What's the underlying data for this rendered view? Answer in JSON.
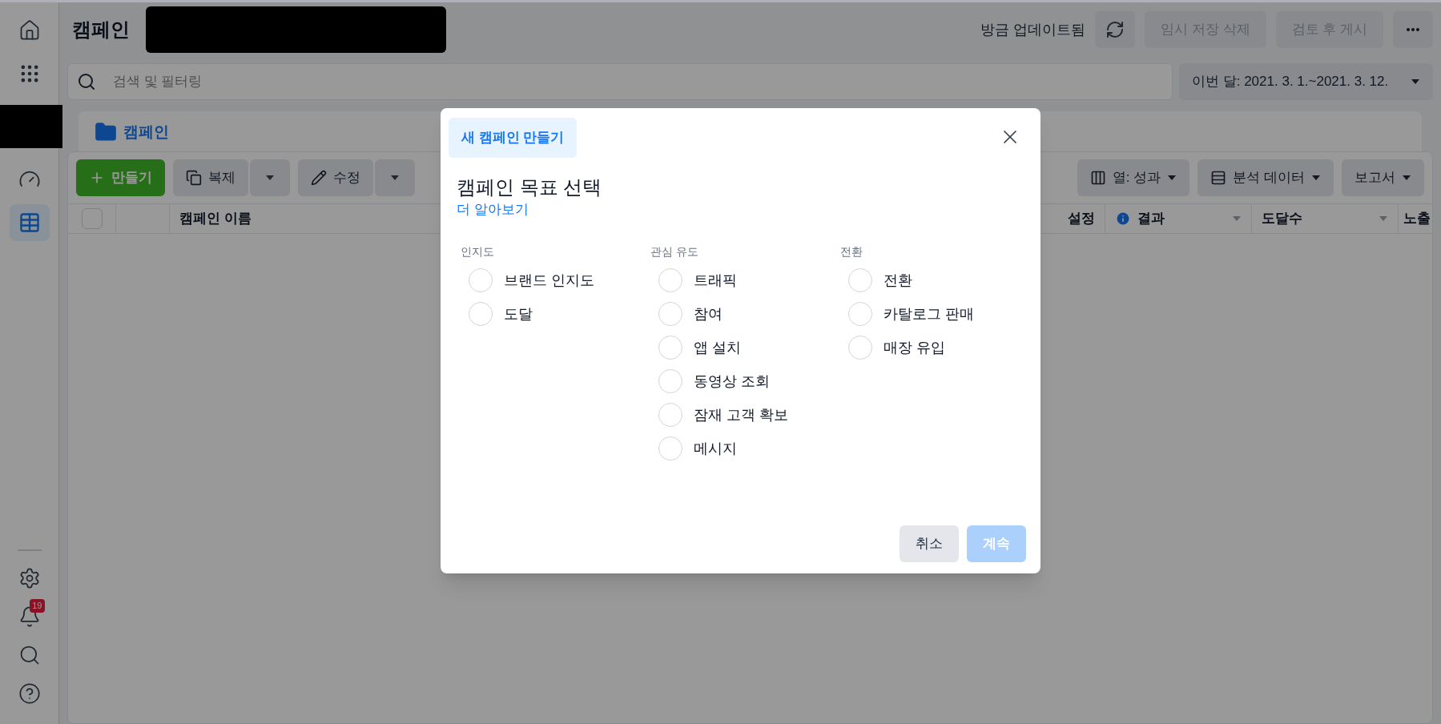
{
  "sidebar": {
    "top_items": [
      {
        "kind": "home",
        "selected": false
      },
      {
        "kind": "apps",
        "selected": false
      },
      {
        "kind": "gauge",
        "selected": false
      },
      {
        "kind": "table",
        "selected": true
      }
    ],
    "bottom_items": [
      {
        "kind": "settings"
      },
      {
        "kind": "bell",
        "badge": "19"
      },
      {
        "kind": "search"
      },
      {
        "kind": "help"
      }
    ]
  },
  "header": {
    "title": "캠페인",
    "status": "방금 업데이트됨",
    "buttons": [
      {
        "label": "임시 저장 삭제",
        "disabled": true
      },
      {
        "label": "검토 후 게시",
        "disabled": true
      }
    ]
  },
  "search": {
    "placeholder": "검색 및 필터링"
  },
  "date_range": "이번 달: 2021. 3. 1.~2021. 3. 12.",
  "tabs": [
    {
      "label": "캠페인",
      "selected": true
    }
  ],
  "toolbar": {
    "create": "만들기",
    "duplicate": "복제",
    "edit": "수정",
    "columns": "열: 성과",
    "breakdown": "분석 데이터",
    "reports": "보고서"
  },
  "table": {
    "select_all": {
      "checked": false
    },
    "columns": [
      {
        "label": "캠페인 이름",
        "info": false
      },
      {
        "label": "설정",
        "info": false
      },
      {
        "label": "결과",
        "info": true
      },
      {
        "label": "도달수",
        "info": false
      },
      {
        "label": "노출",
        "info": false
      }
    ]
  },
  "dialog": {
    "chip": "새 캠페인 만들기",
    "title": "캠페인 목표 선택",
    "link": "더 알아보기",
    "groups": [
      {
        "label": "인지도",
        "options": [
          {
            "label": "브랜드 인지도",
            "selected": false
          },
          {
            "label": "도달",
            "selected": false
          }
        ]
      },
      {
        "label": "관심 유도",
        "options": [
          {
            "label": "트래픽",
            "selected": false
          },
          {
            "label": "참여",
            "selected": false
          },
          {
            "label": "앱 설치",
            "selected": false
          },
          {
            "label": "동영상 조회",
            "selected": false
          },
          {
            "label": "잠재 고객 확보",
            "selected": false
          },
          {
            "label": "메시지",
            "selected": false
          }
        ]
      },
      {
        "label": "전환",
        "options": [
          {
            "label": "전환",
            "selected": false
          },
          {
            "label": "카탈로그 판매",
            "selected": false
          },
          {
            "label": "매장 유입",
            "selected": false
          }
        ]
      }
    ],
    "cancel": "취소",
    "continue": {
      "label": "계속",
      "disabled": true
    }
  }
}
